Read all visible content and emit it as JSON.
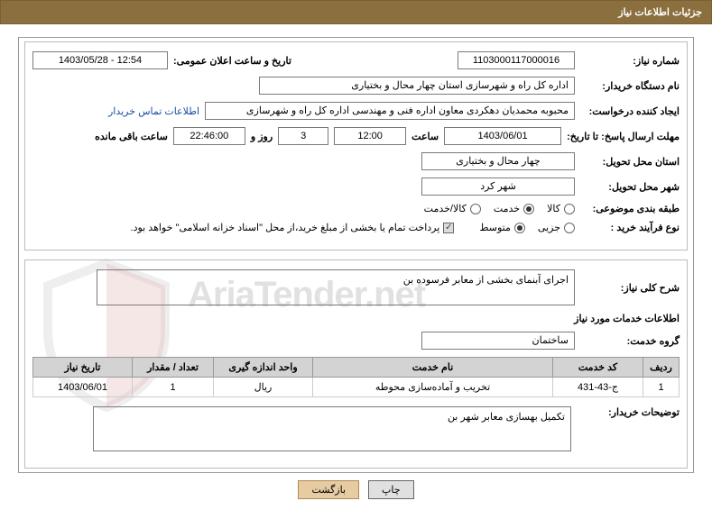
{
  "title": "جزئیات اطلاعات نیاز",
  "labels": {
    "request_no": "شماره نیاز:",
    "announce_dt": "تاریخ و ساعت اعلان عمومی:",
    "buyer_org": "نام دستگاه خریدار:",
    "creator": "ایجاد کننده درخواست:",
    "buyer_contact": "اطلاعات تماس خریدار",
    "deadline": "مهلت ارسال پاسخ: تا تاریخ:",
    "hour": "ساعت",
    "days_remain": "روز و",
    "time_remain": "ساعت باقی مانده",
    "delivery_province": "استان محل تحویل:",
    "delivery_city": "شهر محل تحویل:",
    "subject_class": "طبقه بندی موضوعی:",
    "purchase_type": "نوع فرآیند خرید :",
    "payment_note": "پرداخت تمام یا بخشی از مبلغ خرید،از محل \"اسناد خزانه اسلامی\" خواهد بود.",
    "need_desc": "شرح کلی نیاز:",
    "services_info": "اطلاعات خدمات مورد نیاز",
    "service_group": "گروه خدمت:",
    "buyer_notes": "توضیحات خریدار:"
  },
  "fields": {
    "request_no": "1103000117000016",
    "announce_dt": "1403/05/28 - 12:54",
    "buyer_org": "اداره کل راه و شهرسازی استان چهار محال و بختیاری",
    "creator": "محبوبه محمدیان دهکردی معاون اداره فنی و مهندسی اداره کل راه و شهرسازی",
    "deadline_date": "1403/06/01",
    "deadline_time": "12:00",
    "remain_days": "3",
    "remain_clock": "22:46:00",
    "delivery_province": "چهار محال و بختیاری",
    "delivery_city": "شهر کرد",
    "service_group": "ساختمان",
    "need_desc_text": "اجرای آبنمای بخشی از معابر فرسوده بن",
    "buyer_notes_text": "تکمیل بهسازی معابر شهر بن"
  },
  "subject_class_options": [
    "کالا",
    "خدمت",
    "کالا/خدمت"
  ],
  "subject_class_selected": 1,
  "purchase_type_options": [
    "جزیی",
    "متوسط"
  ],
  "purchase_type_selected": 1,
  "payment_checked": true,
  "table": {
    "headers": [
      "ردیف",
      "کد خدمت",
      "نام خدمت",
      "واحد اندازه گیری",
      "تعداد / مقدار",
      "تاریخ نیاز"
    ],
    "rows": [
      {
        "idx": "1",
        "code": "ج-43-431",
        "name": "تخریب و آماده‌سازی محوطه",
        "unit": "ریال",
        "qty": "1",
        "date": "1403/06/01"
      }
    ]
  },
  "buttons": {
    "print": "چاپ",
    "back": "بازگشت"
  },
  "watermark": "AriaTender.net"
}
